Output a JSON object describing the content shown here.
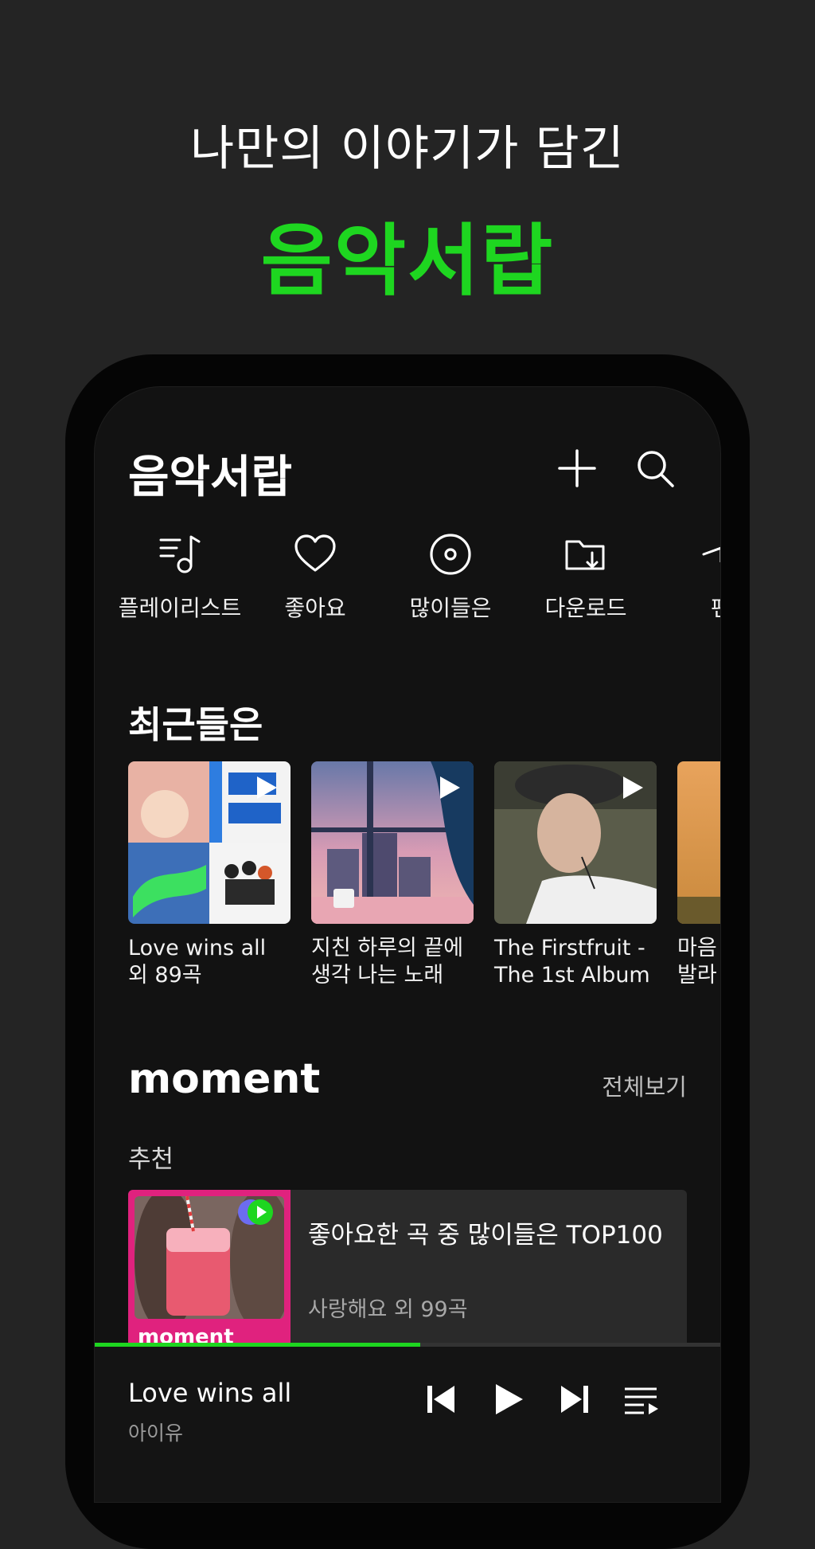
{
  "promo": {
    "line1": "나만의 이야기가 담긴",
    "line2": "음악서랍"
  },
  "header": {
    "title": "음악서랍",
    "add_icon": "plus-icon",
    "search_icon": "search-icon"
  },
  "quick_menu": [
    {
      "label": "플레이리스트",
      "icon": "playlist-music-icon"
    },
    {
      "label": "좋아요",
      "icon": "heart-icon"
    },
    {
      "label": "많이들은",
      "icon": "disc-icon"
    },
    {
      "label": "다운로드",
      "icon": "folder-download-icon"
    },
    {
      "label": "팬",
      "icon": "partial-icon"
    }
  ],
  "recent": {
    "title": "최근들은",
    "albums": [
      {
        "line1": "Love wins all",
        "line2": "외 89곡"
      },
      {
        "line1": "지친 하루의 끝에",
        "line2": "생각 나는 노래"
      },
      {
        "line1": "The Firstfruit -",
        "line2": "The 1st Album"
      },
      {
        "line1": "마음",
        "line2": "발라"
      }
    ]
  },
  "moment": {
    "logo": "moment",
    "see_all": "전체보기",
    "sub_label": "추천",
    "card": {
      "title": "좋아요한 곡 중 많이들은 TOP100",
      "subtitle": "사랑해요 외 99곡",
      "thumb_brand": "moment"
    }
  },
  "player": {
    "title": "Love wins all",
    "artist": "아이유",
    "progress": 0.52
  },
  "colors": {
    "accent": "#1ed620",
    "background": "#242424",
    "screen": "#121212"
  }
}
